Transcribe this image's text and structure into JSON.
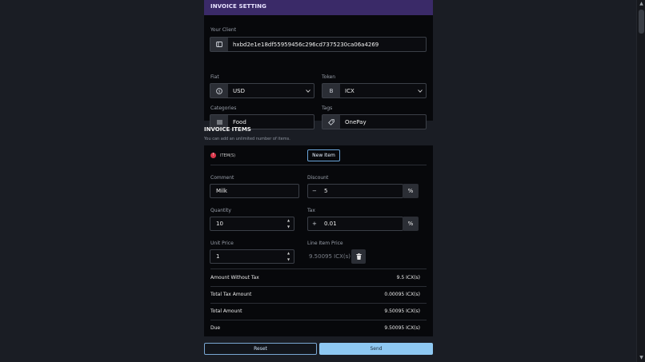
{
  "header": {
    "title": "INVOICE SETTING"
  },
  "settings": {
    "client": {
      "label": "Your Client",
      "value": "hxbd2e1e18df55959456c296cd7375230ca06a4269",
      "icon": "wallet-icon"
    },
    "fiat": {
      "label": "Fiat",
      "value": "USD",
      "icon": "dollar-coin-icon"
    },
    "token": {
      "label": "Token",
      "value": "ICX",
      "icon": "token-icon",
      "prefix_text": "B"
    },
    "categories": {
      "label": "Categories",
      "value": "Food",
      "icon": "list-icon"
    },
    "tags": {
      "label": "Tags",
      "value": "OnePay",
      "icon": "tag-icon"
    }
  },
  "items_section": {
    "title": "INVOICE ITEMS",
    "subtitle": "You can add an unlimited number of items.",
    "items_count_label": "ITEM(S)",
    "badge": "!",
    "new_item_label": "New Item"
  },
  "item": {
    "comment": {
      "label": "Comment",
      "value": "Milk"
    },
    "discount": {
      "label": "Discount",
      "sign": "−",
      "value": "5",
      "unit": "%"
    },
    "quantity": {
      "label": "Quantity",
      "value": "10"
    },
    "tax": {
      "label": "Tax",
      "sign": "+",
      "value": "0.01",
      "unit": "%"
    },
    "unit_price": {
      "label": "Unit Price",
      "value": "1"
    },
    "line_item_price": {
      "label": "Line Item Price",
      "value": "9.50095 ICX(s)"
    }
  },
  "summary": [
    {
      "label": "Amount Without Tax",
      "value": "9.5 ICX(s)"
    },
    {
      "label": "Total Tax Amount",
      "value": "0.00095 ICX(s)"
    },
    {
      "label": "Total Amount",
      "value": "9.50095 ICX(s)"
    },
    {
      "label": "Due",
      "value": "9.50095 ICX(s)"
    }
  ],
  "actions": {
    "reset_label": "Reset",
    "send_label": "Send"
  },
  "colors": {
    "header_bg": "#3a2a68",
    "accent": "#8ec8f2",
    "badge": "#d9364a"
  }
}
